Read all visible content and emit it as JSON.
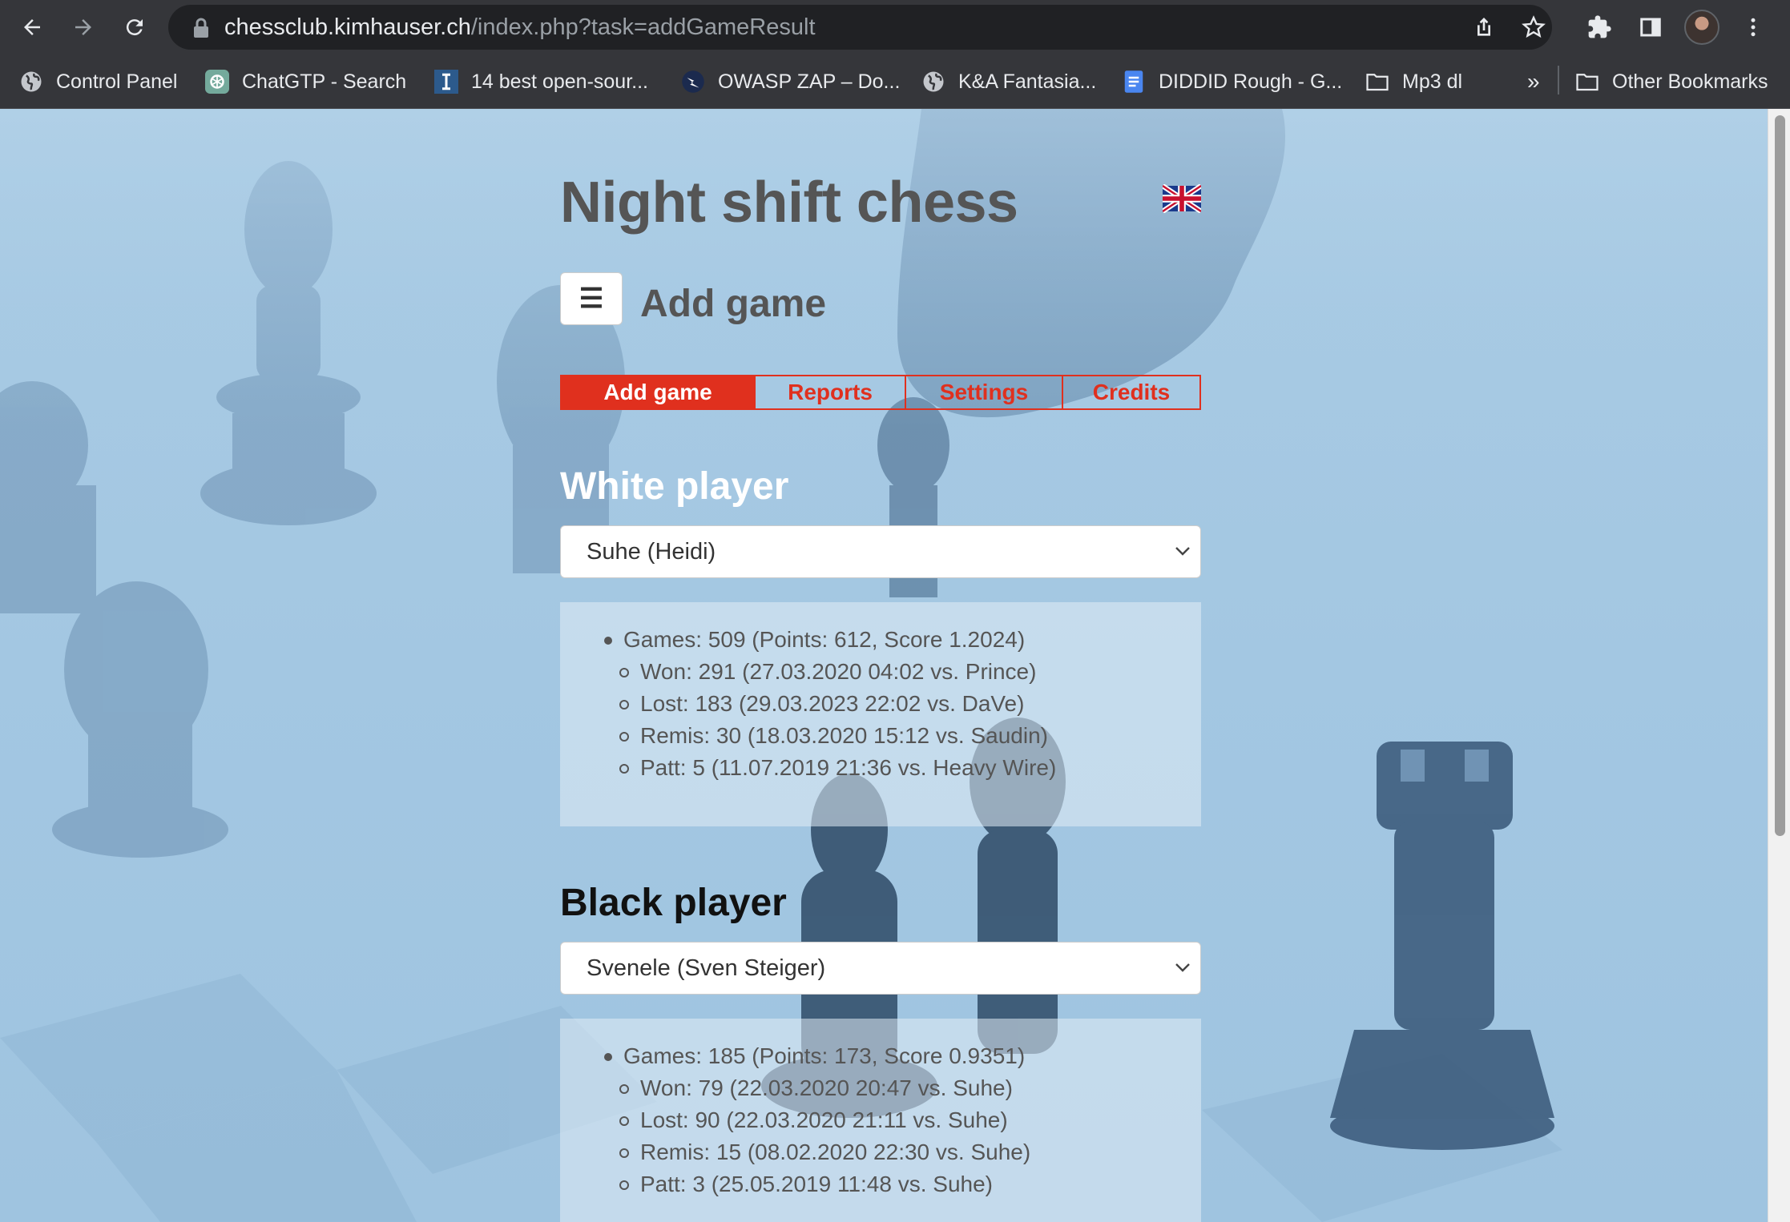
{
  "browser": {
    "url_host": "chessclub.kimhauser.ch",
    "url_path": "/index.php?task=addGameResult",
    "bookmarks": [
      {
        "label": "Control Panel",
        "icon": "globe-icon"
      },
      {
        "label": "ChatGTP - Search",
        "icon": "openai-icon"
      },
      {
        "label": "14 best open-sour...",
        "icon": "i-logo-icon"
      },
      {
        "label": "OWASP ZAP – Do...",
        "icon": "zap-icon"
      },
      {
        "label": "K&A Fantasia...",
        "icon": "globe-icon"
      },
      {
        "label": "DIDDID Rough - G...",
        "icon": "docs-icon"
      },
      {
        "label": "Mp3 dl",
        "icon": "folder-icon"
      }
    ],
    "overflow_label": "»",
    "other_bookmarks": "Other Bookmarks"
  },
  "page": {
    "site_title": "Night shift chess",
    "menu_glyph": "☰",
    "heading": "Add game",
    "tabs": [
      {
        "label": "Add game",
        "active": true
      },
      {
        "label": "Reports",
        "active": false
      },
      {
        "label": "Settings",
        "active": false
      },
      {
        "label": "Credits",
        "active": false
      }
    ],
    "white": {
      "title": "White player",
      "selected": "Suhe (Heidi)",
      "games": "Games: 509 (Points: 612, Score 1.2024)",
      "won": "Won: 291 (27.03.2020 04:02 vs. Prince)",
      "lost": "Lost: 183 (29.03.2023 22:02 vs. DaVe)",
      "remis": "Remis: 30 (18.03.2020 15:12 vs. Saudin)",
      "patt": "Patt: 5 (11.07.2019 21:36 vs. Heavy Wire)"
    },
    "black": {
      "title": "Black player",
      "selected": "Svenele (Sven Steiger)",
      "games": "Games: 185 (Points: 173, Score 0.9351)",
      "won": "Won: 79 (22.03.2020 20:47 vs. Suhe)",
      "lost": "Lost: 90 (22.03.2020 21:11 vs. Suhe)",
      "remis": "Remis: 15 (08.02.2020 22:30 vs. Suhe)",
      "patt": "Patt: 3 (25.05.2019 11:48 vs. Suhe)"
    },
    "colors": {
      "accent": "#e0301e",
      "white_title": "#ffffff",
      "black_title": "#111111",
      "text": "#555555"
    }
  }
}
